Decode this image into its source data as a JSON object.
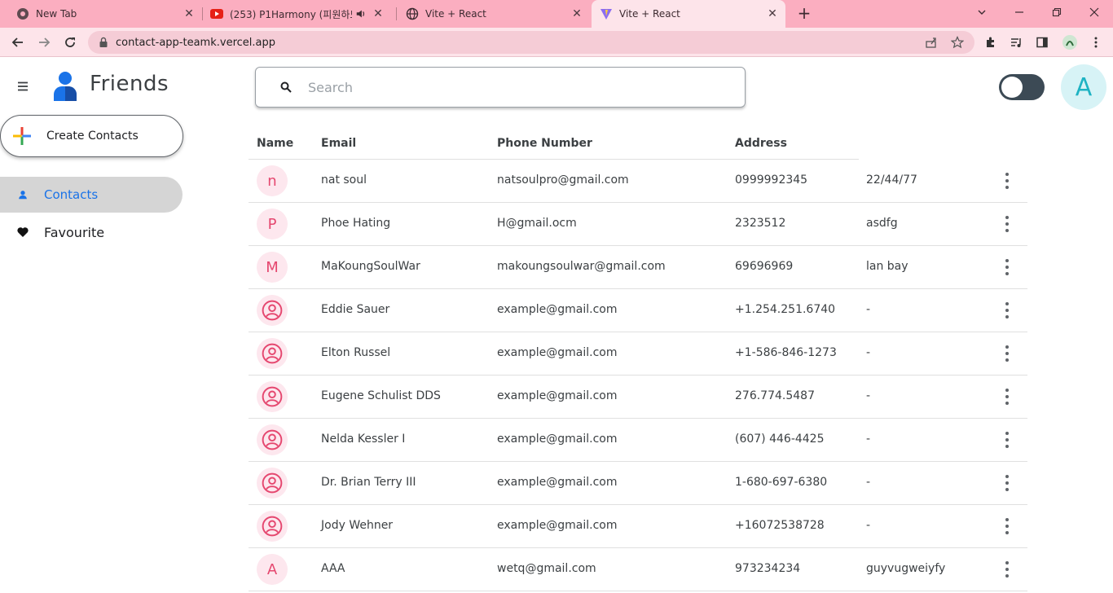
{
  "browser": {
    "tabs": [
      {
        "title": "New Tab"
      },
      {
        "title": "(253) P1Harmony (피원하모니"
      },
      {
        "title": "Vite + React"
      },
      {
        "title": "Vite + React"
      }
    ],
    "url": "contact-app-teamk.vercel.app"
  },
  "app": {
    "title": "Friends",
    "search_placeholder": "Search",
    "avatar_letter": "A",
    "create_label": "Create Contacts",
    "nav": [
      {
        "label": "Contacts",
        "selected": true
      },
      {
        "label": "Favourite",
        "selected": false
      }
    ]
  },
  "table": {
    "headers": [
      "Name",
      "Email",
      "Phone Number",
      "Address"
    ],
    "rows": [
      {
        "initial": "n",
        "name": "nat soul",
        "email": "natsoulpro@gmail.com",
        "phone": "0999992345",
        "address": "22/44/77"
      },
      {
        "initial": "P",
        "name": "Phoe Hating",
        "email": "H@gmail.ocm",
        "phone": "2323512",
        "address": "asdfg"
      },
      {
        "initial": "M",
        "name": "MaKoungSoulWar",
        "email": "makoungsoulwar@gmail.com",
        "phone": "69696969",
        "address": "lan bay"
      },
      {
        "initial": "",
        "name": "Eddie Sauer",
        "email": "example@gmail.com",
        "phone": "+1.254.251.6740",
        "address": "-"
      },
      {
        "initial": "",
        "name": "Elton Russel",
        "email": "example@gmail.com",
        "phone": "+1-586-846-1273",
        "address": "-"
      },
      {
        "initial": "",
        "name": "Eugene Schulist DDS",
        "email": "example@gmail.com",
        "phone": "276.774.5487",
        "address": "-"
      },
      {
        "initial": "",
        "name": "Nelda Kessler I",
        "email": "example@gmail.com",
        "phone": "(607) 446-4425",
        "address": "-"
      },
      {
        "initial": "",
        "name": "Dr. Brian Terry III",
        "email": "example@gmail.com",
        "phone": "1-680-697-6380",
        "address": "-"
      },
      {
        "initial": "",
        "name": "Jody Wehner",
        "email": "example@gmail.com",
        "phone": "+16072538728",
        "address": "-"
      },
      {
        "initial": "A",
        "name": "AAA",
        "email": "wetq@gmail.com",
        "phone": "973234234",
        "address": "guyvugweiyfy"
      }
    ]
  },
  "colors": {
    "tabbar": "#fbaec0",
    "toolbar": "#fde4ea",
    "accent_pink": "#e5476f",
    "avatar_bg": "#d7f3f6"
  }
}
